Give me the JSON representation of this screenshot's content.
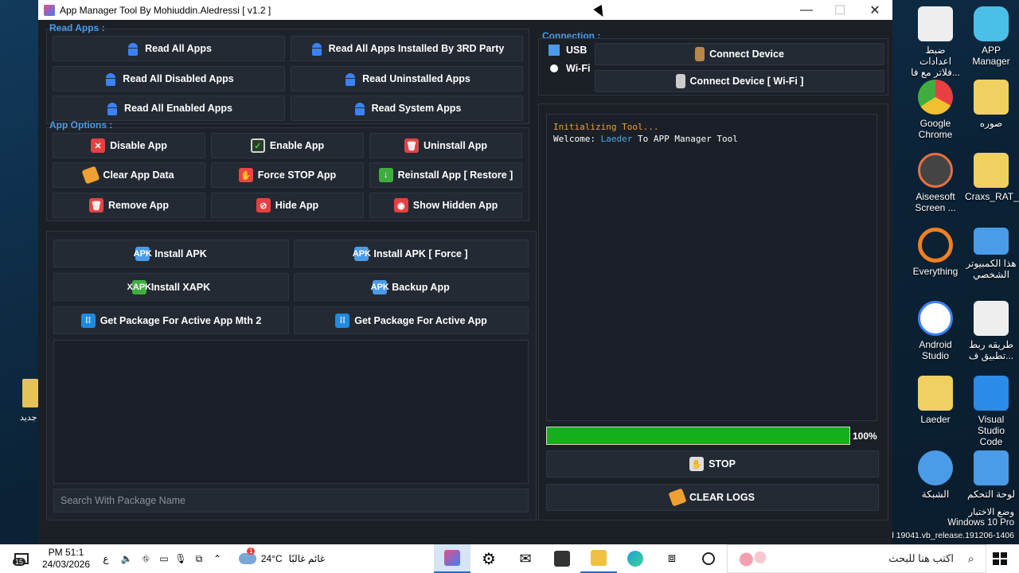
{
  "window": {
    "title": "App Manager Tool By Mohiuddin.Aledressi  [ v1.2 ]",
    "minimize": "—",
    "maximize": "☐",
    "close": "✕"
  },
  "read_apps": {
    "label": "Read Apps :",
    "buttons": [
      "Read All Apps",
      "Read All Apps Installed By 3RD Party",
      "Read All Disabled Apps",
      "Read Uninstalled Apps",
      "Read All Enabled Apps",
      "Read System Apps"
    ]
  },
  "app_options": {
    "label": "App Options :",
    "buttons": [
      "Disable App",
      "Enable App",
      "Uninstall App",
      "Clear App Data",
      "Force STOP App",
      "Reinstall App [ Restore ]",
      "Remove App",
      "Hide App",
      "Show Hidden App"
    ]
  },
  "install": {
    "buttons": [
      "Install APK",
      "Install APK [ Force ]",
      "Install XAPK",
      "Backup App",
      "Get Package For  Active App Mth 2",
      "Get Package For  Active App"
    ],
    "apk_tag": "APK",
    "xapk_tag": "XAPK"
  },
  "search": {
    "placeholder": "Search With Package Name"
  },
  "connection": {
    "label": "Connection :",
    "usb": "USB",
    "wifi": "Wi-Fi",
    "selected": "USB",
    "connect": "Connect Device",
    "connect_wifi": "Connect Device [ Wi-Fi ]"
  },
  "console": {
    "line1": "Initializing Tool...",
    "line2_prefix": "Welcome: ",
    "line2_user": "Laeder",
    "line2_suffix": " To APP Manager Tool"
  },
  "progress": {
    "percent": 100,
    "label": "100%",
    "color": "#14b01c"
  },
  "actions": {
    "stop": "STOP",
    "clear_logs": "CLEAR LOGS"
  },
  "desktop_icons": [
    {
      "label": "ضبط اعدادات فلاتر مع فا...",
      "color": "#e8e8e8"
    },
    {
      "label": "APP Manager",
      "color": "#4ac0e8"
    },
    {
      "label": "Google Chrome",
      "color": "#e8a030"
    },
    {
      "label": "صوره",
      "color": "#f0d060"
    },
    {
      "label": "Aiseesoft Screen ...",
      "color": "#555"
    },
    {
      "label": "Craxs_RAT_...",
      "color": "#f0d060"
    },
    {
      "label": "Everything",
      "color": "#f08020"
    },
    {
      "label": "هذا الكمبيوتر الشخصي",
      "color": "#4a9be8"
    },
    {
      "label": "Android Studio",
      "color": "#3b82f6"
    },
    {
      "label": "طريقه ربط تطبيق ف...",
      "color": "#e8e8e8"
    },
    {
      "label": "Laeder",
      "color": "#f0d060"
    },
    {
      "label": "Visual Studio Code",
      "color": "#2a8be8"
    },
    {
      "label": "الشبكة",
      "color": "#4a9be8"
    },
    {
      "label": "لوحة التحكم",
      "color": "#4a9be8"
    }
  ],
  "left_peek_label": "جديد",
  "watermark": {
    "line1": "وضع الاختبار",
    "line2": "Windows 10 Pro",
    "line3": "d 19041.vb_release.191206-1406"
  },
  "taskbar": {
    "time": "PM 51:1",
    "date": "24/03/2026",
    "notif_count": "15",
    "lang": "ع",
    "weather_temp": "24°C",
    "weather_text": "غائم غالبًا",
    "weather_badge": "1",
    "search_placeholder": "اكتب هنا للبحث"
  }
}
